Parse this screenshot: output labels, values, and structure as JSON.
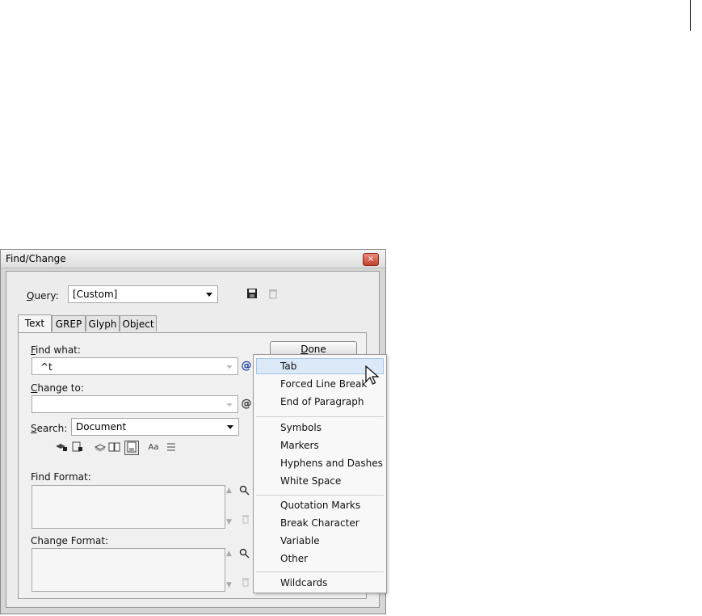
{
  "dialog": {
    "title": "Find/Change",
    "close_glyph": "×",
    "query": {
      "label_prefix": "",
      "label_underlined": "Q",
      "label_rest": "uery:",
      "value": "[Custom]"
    },
    "tabs": [
      {
        "label": "Text"
      },
      {
        "label": "GREP"
      },
      {
        "label": "Glyph"
      },
      {
        "label": "Object"
      }
    ],
    "find_what": {
      "label_underlined": "F",
      "label_rest": "ind what:",
      "value": "^t"
    },
    "change_to": {
      "label_underlined": "C",
      "label_rest": "hange to:",
      "value": ""
    },
    "search": {
      "label_underlined": "S",
      "label_rest": "earch:",
      "value": "Document"
    },
    "done_button": {
      "label_underlined": "D",
      "label_rest": "one"
    },
    "find_format_label": "Find Format:",
    "change_format_label": "Change Format:",
    "option_icons": [
      "lock-layers-icon",
      "lock-stories-icon",
      "hidden-layers-icon",
      "master-pages-icon",
      "footnotes-icon",
      "case-sensitive-icon",
      "whole-word-icon"
    ],
    "case_sensitive_glyph": "Aa"
  },
  "special_char_menu": {
    "groups": [
      [
        "Tab",
        "Forced Line Break",
        "End of Paragraph"
      ],
      [
        "Symbols",
        "Markers",
        "Hyphens and Dashes",
        "White Space"
      ],
      [
        "Quotation Marks",
        "Break Character",
        "Variable",
        "Other"
      ],
      [
        "Wildcards"
      ]
    ],
    "highlighted": "Tab"
  },
  "colors": {
    "highlight": "#dbe8f7",
    "close": "#c4402e",
    "special_icon": "#1a3fa0"
  }
}
